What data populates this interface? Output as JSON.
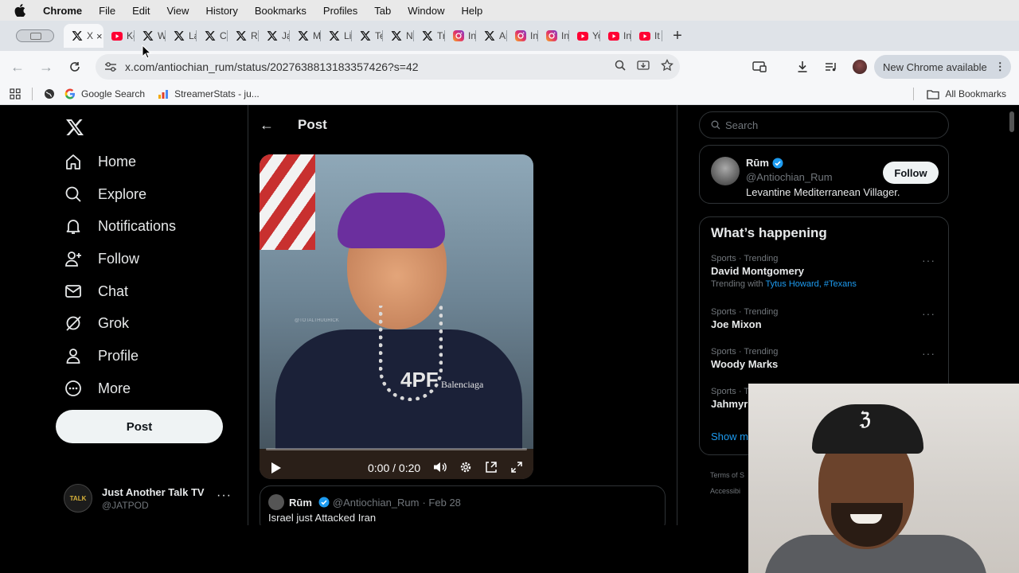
{
  "menubar": {
    "app": "Chrome",
    "items": [
      "File",
      "Edit",
      "View",
      "History",
      "Bookmarks",
      "Profiles",
      "Tab",
      "Window",
      "Help"
    ]
  },
  "tabs": [
    {
      "icon": "x",
      "title": "X",
      "active": true
    },
    {
      "icon": "youtube",
      "title": "Ke"
    },
    {
      "icon": "x",
      "title": "W"
    },
    {
      "icon": "x",
      "title": "La"
    },
    {
      "icon": "x",
      "title": "Cl"
    },
    {
      "icon": "x",
      "title": "Re"
    },
    {
      "icon": "x",
      "title": "Ja"
    },
    {
      "icon": "x",
      "title": "M"
    },
    {
      "icon": "x",
      "title": "Li"
    },
    {
      "icon": "x",
      "title": "Te"
    },
    {
      "icon": "x",
      "title": "N"
    },
    {
      "icon": "x",
      "title": "Tr"
    },
    {
      "icon": "instagram",
      "title": "In"
    },
    {
      "icon": "x",
      "title": "Ar"
    },
    {
      "icon": "instagram",
      "title": "In"
    },
    {
      "icon": "instagram",
      "title": "In"
    },
    {
      "icon": "youtube",
      "title": "Yo"
    },
    {
      "icon": "youtube",
      "title": "In"
    },
    {
      "icon": "youtube",
      "title": "It"
    }
  ],
  "toolbar": {
    "url": "x.com/antiochian_rum/status/2027638813183357426?s=42",
    "update_label": "New Chrome available"
  },
  "bookmarks": {
    "items": [
      "Google Search",
      "StreamerStats - ju..."
    ],
    "all_label": "All Bookmarks"
  },
  "nav": {
    "items": [
      {
        "label": "Home",
        "icon": "home"
      },
      {
        "label": "Explore",
        "icon": "search"
      },
      {
        "label": "Notifications",
        "icon": "bell"
      },
      {
        "label": "Follow",
        "icon": "person-plus"
      },
      {
        "label": "Chat",
        "icon": "mail"
      },
      {
        "label": "Grok",
        "icon": "grok"
      },
      {
        "label": "Profile",
        "icon": "person"
      },
      {
        "label": "More",
        "icon": "more-circle"
      }
    ],
    "post_label": "Post"
  },
  "account": {
    "name": "Just Another Talk TV",
    "handle": "@JATPOD",
    "avatar_text": "TALK"
  },
  "post": {
    "header": "Post",
    "video": {
      "time": "0:00 / 0:20",
      "watermark": "@TOTALTHUGRICK",
      "pendant": "4PF",
      "brand": "Balenciaga"
    },
    "quoted": {
      "name": "Rūm",
      "handle": "@Antiochian_Rum",
      "date": "· Feb 28",
      "text": "Israel just Attacked Iran"
    }
  },
  "sidebar": {
    "search_placeholder": "Search",
    "profile": {
      "name": "Rūm",
      "handle": "@Antiochian_Rum",
      "bio": "Levantine Mediterranean Villager.",
      "follow_label": "Follow"
    },
    "happening_title": "What’s happening",
    "trends": [
      {
        "meta": "Sports · Trending",
        "name": "David Montgomery",
        "with_label": "Trending with",
        "links": "Tytus Howard, #Texans"
      },
      {
        "meta": "Sports · Trending",
        "name": "Joe Mixon"
      },
      {
        "meta": "Sports · Trending",
        "name": "Woody Marks"
      },
      {
        "meta": "Sports · Trending",
        "name": "Jahmyr"
      }
    ],
    "show_more": "Show m",
    "terms": "Terms of S",
    "accessibility": "Accessibi"
  },
  "colors": {
    "x_blue": "#1d9bf0",
    "verified": "#1d9bf0",
    "youtube": "#ff0033",
    "instagram": "#e1306c"
  }
}
